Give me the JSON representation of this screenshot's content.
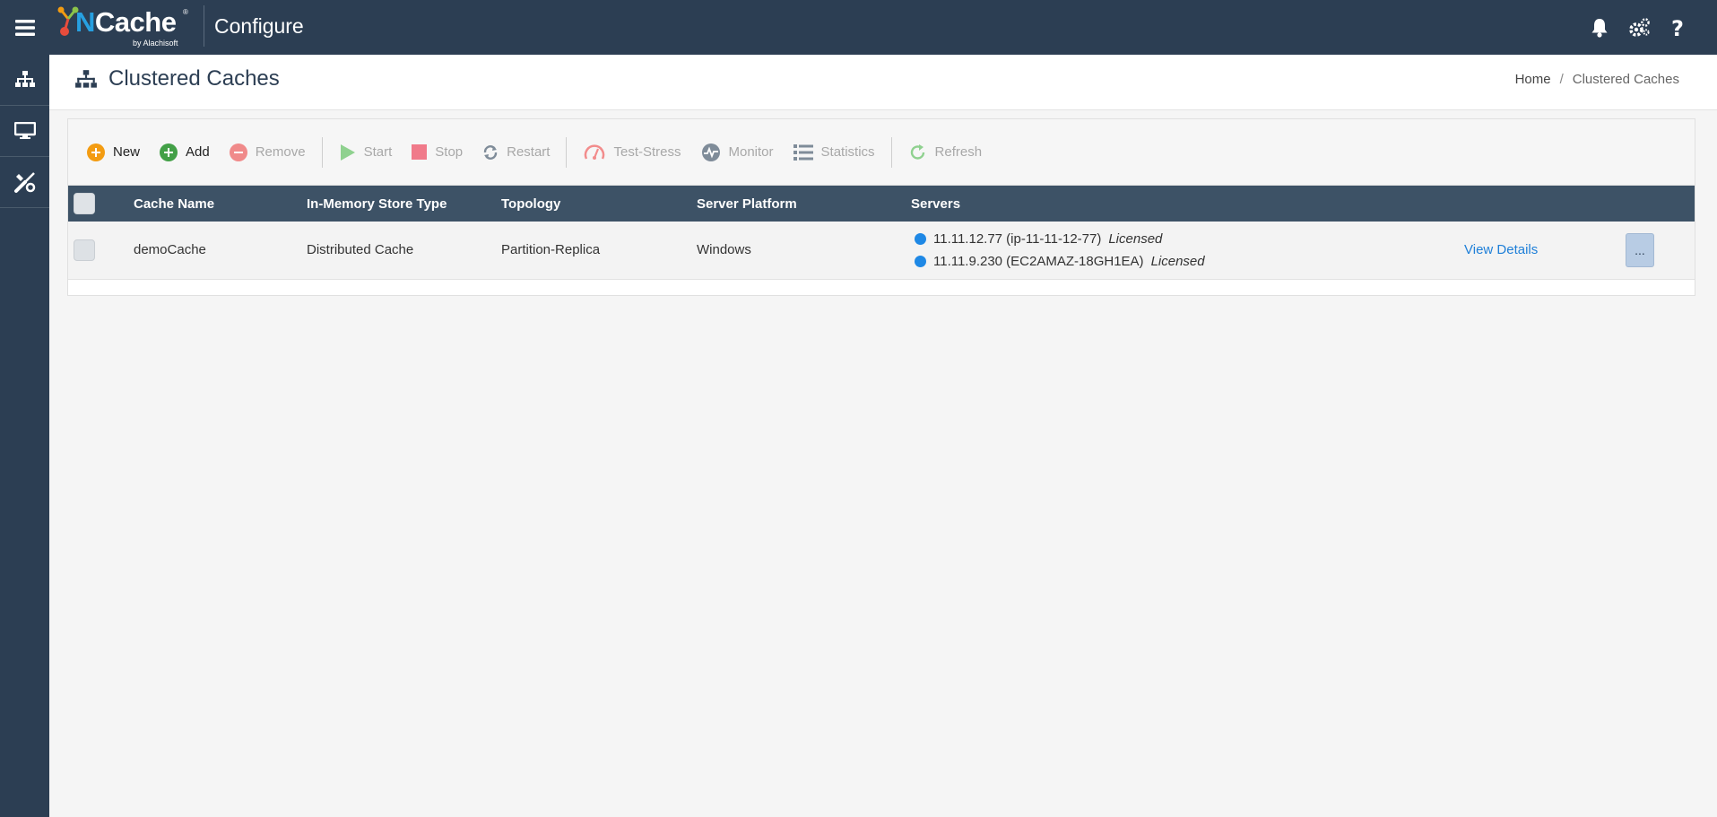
{
  "header": {
    "logo_text_n": "N",
    "logo_text_rest": "Cache",
    "logo_sub": "by Alachisoft",
    "app_title": "Configure",
    "icons": [
      "bell-icon",
      "gears-icon",
      "help-icon"
    ]
  },
  "sidebar": {
    "items": [
      {
        "icon": "sitemap-icon"
      },
      {
        "icon": "monitor-icon"
      },
      {
        "icon": "tools-icon"
      }
    ]
  },
  "page": {
    "title": "Clustered Caches",
    "breadcrumb": {
      "home": "Home",
      "separator": "/",
      "current": "Clustered Caches"
    }
  },
  "toolbar": {
    "new": "New",
    "add": "Add",
    "remove": "Remove",
    "start": "Start",
    "stop": "Stop",
    "restart": "Restart",
    "test_stress": "Test-Stress",
    "monitor": "Monitor",
    "statistics": "Statistics",
    "refresh": "Refresh"
  },
  "table": {
    "columns": {
      "cache_name": "Cache Name",
      "store_type": "In-Memory Store Type",
      "topology": "Topology",
      "platform": "Server Platform",
      "servers": "Servers"
    },
    "rows": [
      {
        "cache_name": "demoCache",
        "store_type": "Distributed Cache",
        "topology": "Partition-Replica",
        "platform": "Windows",
        "servers": [
          {
            "address": "11.11.12.77 (ip-11-11-12-77)",
            "status": "Licensed"
          },
          {
            "address": "11.11.9.230 (EC2AMAZ-18GH1EA)",
            "status": "Licensed"
          }
        ],
        "view_details": "View Details",
        "more": "..."
      }
    ]
  },
  "colors": {
    "topbar": "#2c3e53",
    "table_header": "#3d5266",
    "link": "#1e7fd8",
    "server_dot": "#1e88e5"
  }
}
